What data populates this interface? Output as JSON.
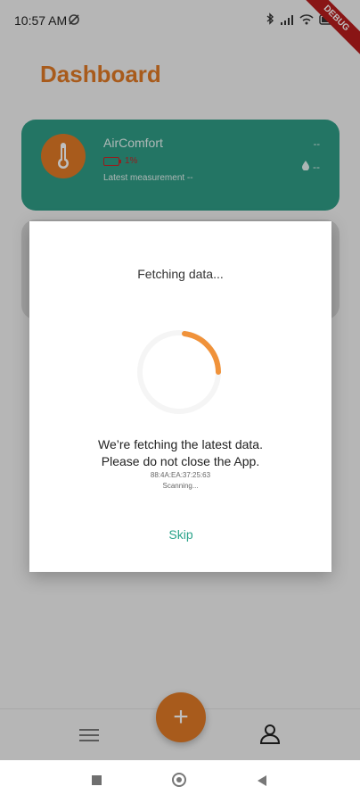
{
  "status_bar": {
    "time": "10:57 AM"
  },
  "debug_banner": "DEBUG",
  "header": {
    "title": "Dashboard"
  },
  "device_card": {
    "name": "AirComfort",
    "battery_text": "1%",
    "latest_measurement": "Latest measurement --",
    "temperature": "--",
    "humidity": "--"
  },
  "dialog": {
    "title": "Fetching data...",
    "message_line1": "We’re fetching the latest data.",
    "message_line2": "Please do not close the App.",
    "mac": "88:4A:EA:37:25:63",
    "status": "Scanning...",
    "skip_label": "Skip"
  },
  "fab": {
    "label": "+"
  },
  "colors": {
    "accent": "#e07a26",
    "card_green": "#2f9c86",
    "skip_text": "#2aa38a",
    "battery_red": "#c62828"
  },
  "icons": {
    "thermometer": "thermometer-icon",
    "droplet": "droplet-icon",
    "menu": "menu-icon",
    "profile": "profile-icon",
    "bluetooth": "bluetooth-icon",
    "signal": "signal-icon",
    "wifi": "wifi-icon",
    "battery": "battery-icon"
  }
}
